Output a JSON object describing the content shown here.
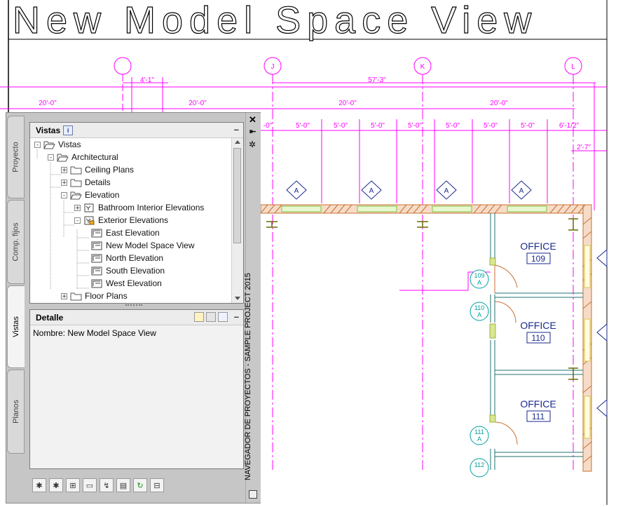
{
  "drawing": {
    "title": "New Model Space View",
    "grid_bubbles": [
      "J",
      "K",
      "L"
    ],
    "dimensions_top": [
      "4'-1\"",
      "57'-3\""
    ],
    "dimensions_row2": [
      "20'-0\"",
      "20'-0\"",
      "20'-0\"",
      "20'-0\""
    ],
    "dimensions_row3": [
      "-0\"",
      "5'-0\"",
      "5'-0\"",
      "5'-0\"",
      "5'-0\"",
      "5'-0\"",
      "5'-0\"",
      "5'-0\"",
      "6'-1/2\""
    ],
    "dimension_side": "2'-7\"",
    "window_tag": "A",
    "rooms": [
      {
        "name": "OFFICE",
        "number": "109"
      },
      {
        "name": "OFFICE",
        "number": "110"
      },
      {
        "name": "OFFICE",
        "number": "111"
      }
    ],
    "door_tags": [
      {
        "num": "109",
        "letter": "A"
      },
      {
        "num": "110",
        "letter": "A"
      },
      {
        "num": "111",
        "letter": "A"
      },
      {
        "num": "112",
        "letter": ""
      }
    ]
  },
  "palette": {
    "tabs": [
      "Proyecto",
      "Comp. fijos",
      "Vistas",
      "Planos"
    ],
    "vertical_title": "NAVEGADOR DE PROYECTOS - SAMPLE PROJECT 2015",
    "views_panel": {
      "title": "Vistas",
      "info_glyph": "i",
      "tree": [
        {
          "label": "Vistas",
          "icon": "folder-open-icon",
          "expander": "-"
        },
        {
          "label": "Architectural",
          "icon": "folder-open-icon",
          "expander": "-"
        },
        {
          "label": "Ceiling Plans",
          "icon": "folder-icon",
          "expander": "+"
        },
        {
          "label": "Details",
          "icon": "folder-icon",
          "expander": "+"
        },
        {
          "label": "Elevation",
          "icon": "folder-open-icon",
          "expander": "-"
        },
        {
          "label": "Bathroom Interior Elevations",
          "icon": "view-set-icon",
          "expander": "+"
        },
        {
          "label": "Exterior Elevations",
          "icon": "view-set-locked-icon",
          "expander": "-"
        },
        {
          "label": "East Elevation",
          "icon": "elevation-view-icon",
          "expander": ""
        },
        {
          "label": "New Model Space View",
          "icon": "elevation-view-icon",
          "expander": ""
        },
        {
          "label": "North Elevation",
          "icon": "elevation-view-icon",
          "expander": ""
        },
        {
          "label": "South Elevation",
          "icon": "elevation-view-icon",
          "expander": ""
        },
        {
          "label": "West Elevation",
          "icon": "elevation-view-icon",
          "expander": ""
        },
        {
          "label": "Floor Plans",
          "icon": "folder-icon",
          "expander": "+"
        }
      ]
    },
    "detail_panel": {
      "title": "Detalle",
      "name_label": "Nombre: New Model Space View"
    },
    "colors": {
      "magenta": "#ff00ff",
      "cyan": "#00a0a0",
      "wall": "#c87030",
      "window": "#90d050"
    }
  }
}
